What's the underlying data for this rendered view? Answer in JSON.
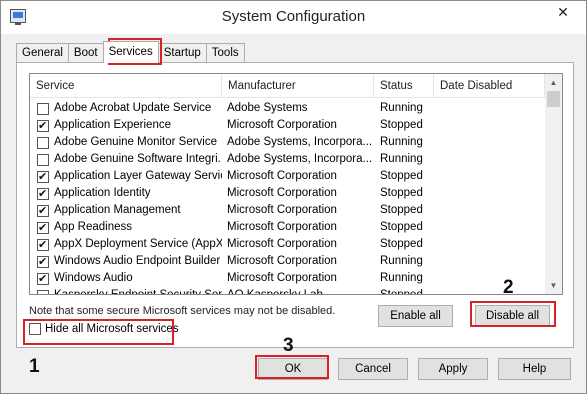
{
  "window": {
    "title": "System Configuration"
  },
  "tabs": [
    "General",
    "Boot",
    "Services",
    "Startup",
    "Tools"
  ],
  "active_tab": "Services",
  "columns": [
    "Service",
    "Manufacturer",
    "Status",
    "Date Disabled"
  ],
  "services": [
    {
      "name": "Adobe Acrobat Update Service",
      "manufacturer": "Adobe Systems",
      "status": "Running",
      "checked": false
    },
    {
      "name": "Application Experience",
      "manufacturer": "Microsoft Corporation",
      "status": "Stopped",
      "checked": true
    },
    {
      "name": "Adobe Genuine Monitor Service",
      "manufacturer": "Adobe Systems, Incorpora...",
      "status": "Running",
      "checked": false
    },
    {
      "name": "Adobe Genuine Software Integri...",
      "manufacturer": "Adobe Systems, Incorpora...",
      "status": "Running",
      "checked": false
    },
    {
      "name": "Application Layer Gateway Service",
      "manufacturer": "Microsoft Corporation",
      "status": "Stopped",
      "checked": true
    },
    {
      "name": "Application Identity",
      "manufacturer": "Microsoft Corporation",
      "status": "Stopped",
      "checked": true
    },
    {
      "name": "Application Management",
      "manufacturer": "Microsoft Corporation",
      "status": "Stopped",
      "checked": true
    },
    {
      "name": "App Readiness",
      "manufacturer": "Microsoft Corporation",
      "status": "Stopped",
      "checked": true
    },
    {
      "name": "AppX Deployment Service (AppX...",
      "manufacturer": "Microsoft Corporation",
      "status": "Stopped",
      "checked": true
    },
    {
      "name": "Windows Audio Endpoint Builder",
      "manufacturer": "Microsoft Corporation",
      "status": "Running",
      "checked": true
    },
    {
      "name": "Windows Audio",
      "manufacturer": "Microsoft Corporation",
      "status": "Running",
      "checked": true
    },
    {
      "name": "Kaspersky Endpoint Security Ser...",
      "manufacturer": "AO Kaspersky Lab",
      "status": "Stopped",
      "checked": false
    }
  ],
  "note": "Note that some secure Microsoft services may not be disabled.",
  "buttons": {
    "enable_all": "Enable all",
    "disable_all": "Disable all",
    "ok": "OK",
    "cancel": "Cancel",
    "apply": "Apply",
    "help": "Help"
  },
  "hide_ms": {
    "label": "Hide all Microsoft services",
    "checked": false
  },
  "annotations": [
    "1",
    "2",
    "3"
  ],
  "colors": {
    "highlight": "#d9212a",
    "window_bg": "#f0f0f0",
    "button_bg": "#e1e1e1"
  },
  "icons": {
    "app": "system-config-icon",
    "close": "close-icon",
    "check": "checkmark-icon"
  }
}
